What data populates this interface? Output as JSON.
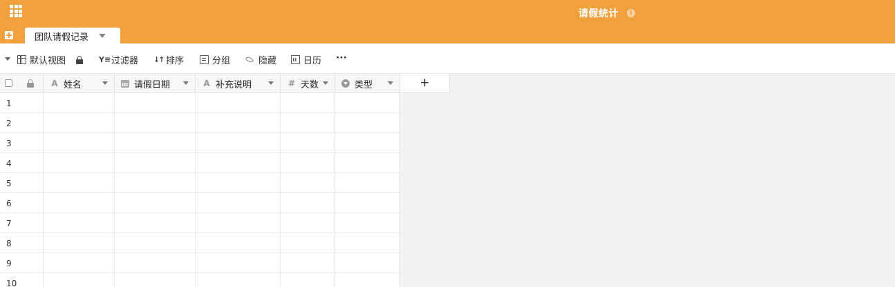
{
  "header": {
    "base_title": "请假统计",
    "info_icon": "info-icon",
    "apps_icon": "app-grid-icon",
    "add_table_icon": "plus-square-icon",
    "bg_color": "#f0a13c"
  },
  "tabs": [
    {
      "label": "团队请假记录",
      "active": true
    }
  ],
  "toolbar": {
    "view_label": "默认视图",
    "filter_label": "过滤器",
    "sort_label": "排序",
    "group_label": "分组",
    "hide_label": "隐藏",
    "calendar_label": "日历",
    "more_label": "···"
  },
  "grid": {
    "columns": [
      {
        "name": "姓名",
        "type": "text",
        "icon": "A"
      },
      {
        "name": "请假日期",
        "type": "date",
        "icon": "calendar-icon"
      },
      {
        "name": "补充说明",
        "type": "text",
        "icon": "A"
      },
      {
        "name": "天数",
        "type": "number",
        "icon": "#"
      },
      {
        "name": "类型",
        "type": "single-select",
        "icon": "select-icon"
      }
    ],
    "add_column_label": "+",
    "rows": [
      "1",
      "2",
      "3",
      "4",
      "5",
      "6",
      "7",
      "8",
      "9",
      "10"
    ]
  }
}
